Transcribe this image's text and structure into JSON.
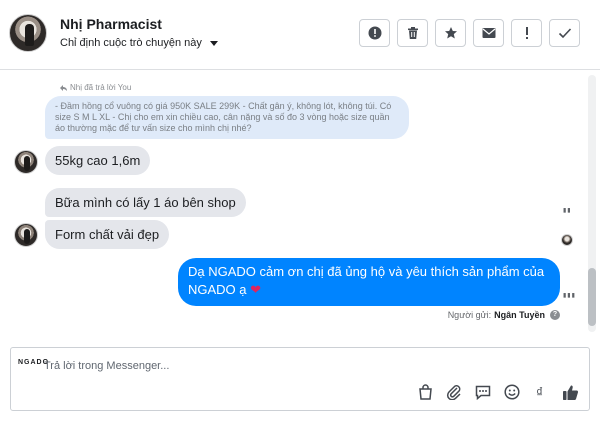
{
  "header": {
    "contact_name": "Nhị Pharmacist",
    "assign_label": "Chỉ định cuộc trò chuyện này",
    "toolbar": [
      {
        "name": "alert-icon",
        "label": "!"
      },
      {
        "name": "trash-icon",
        "label": ""
      },
      {
        "name": "star-icon",
        "label": ""
      },
      {
        "name": "mail-icon",
        "label": ""
      },
      {
        "name": "exclamation-icon",
        "label": "!"
      },
      {
        "name": "check-icon",
        "label": ""
      }
    ]
  },
  "conversation": {
    "replied_note": "Nhị đã trả lời You",
    "quoted_message": "- Đầm hồng cổ vuông có giá 950K SALE 299K - Chất gân ý, không lót, không túi. Có size S M L XL - Chị cho em xin chiều cao, cân nặng và số đo 3 vòng hoặc size quần áo thường mặc để tư vấn size cho mình chị nhé?",
    "incoming": [
      "55kg cao 1,6m",
      "Bữa mình có lấy 1 áo bên shop",
      "Form chất vải đẹp"
    ],
    "outgoing": {
      "text": "Dạ NGADO cảm ơn chị đã ủng hộ và yêu thích sản phẩm của NGADO ạ",
      "emoji": "❤"
    },
    "sender_label": "Người gửi:",
    "sender_name": "Ngân Tuyền"
  },
  "composer": {
    "brand": "NGADO",
    "placeholder": "Trả lời trong Messenger..."
  },
  "colors": {
    "outgoing_bubble": "#0084ff",
    "incoming_bubble": "#e4e6eb",
    "quote_bubble": "#dfeaf9"
  }
}
